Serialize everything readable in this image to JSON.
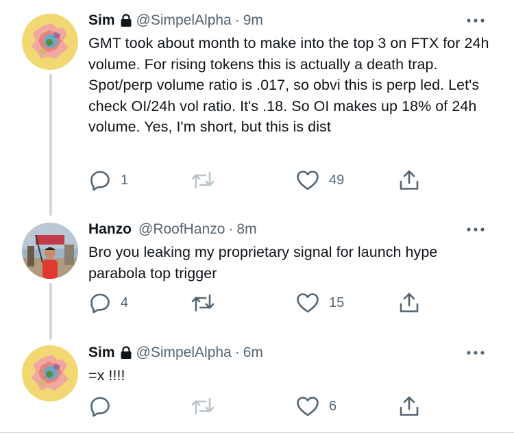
{
  "tweets": [
    {
      "name": "Sim",
      "handle": "@SimpelAlpha",
      "separator": "·",
      "time": "9m",
      "text": "GMT took about month to make into the top 3 on FTX for 24h volume. For rising tokens this is actually a death trap. Spot/perp volume ratio is .017, so obvi this is perp led. Let's check OI/24h vol ratio. It's .18. So OI makes up 18% of 24h volume. Yes, I'm short, but this is dist",
      "reply_count": "1",
      "retweet_count": "",
      "like_count": "49",
      "locked": true
    },
    {
      "name": "Hanzo",
      "handle": "@RoofHanzo",
      "separator": "·",
      "time": "8m",
      "text": "Bro you leaking my proprietary signal for launch hype parabola top trigger",
      "reply_count": "4",
      "retweet_count": "",
      "like_count": "15",
      "locked": false
    },
    {
      "name": "Sim",
      "handle": "@SimpelAlpha",
      "separator": "·",
      "time": "6m",
      "text": "=x !!!!",
      "reply_count": "",
      "retweet_count": "",
      "like_count": "6",
      "locked": true
    }
  ],
  "icons": {
    "lock": "lock-icon",
    "more": "more-icon",
    "reply": "reply-icon",
    "retweet": "retweet-icon",
    "like": "like-icon",
    "share": "share-icon"
  },
  "colors": {
    "text": "#0f1419",
    "muted": "#536471",
    "thread_line": "#cfd9de",
    "avatar_sim_bg": "#f2d873",
    "retweet_disabled": "#b9c3ca"
  }
}
